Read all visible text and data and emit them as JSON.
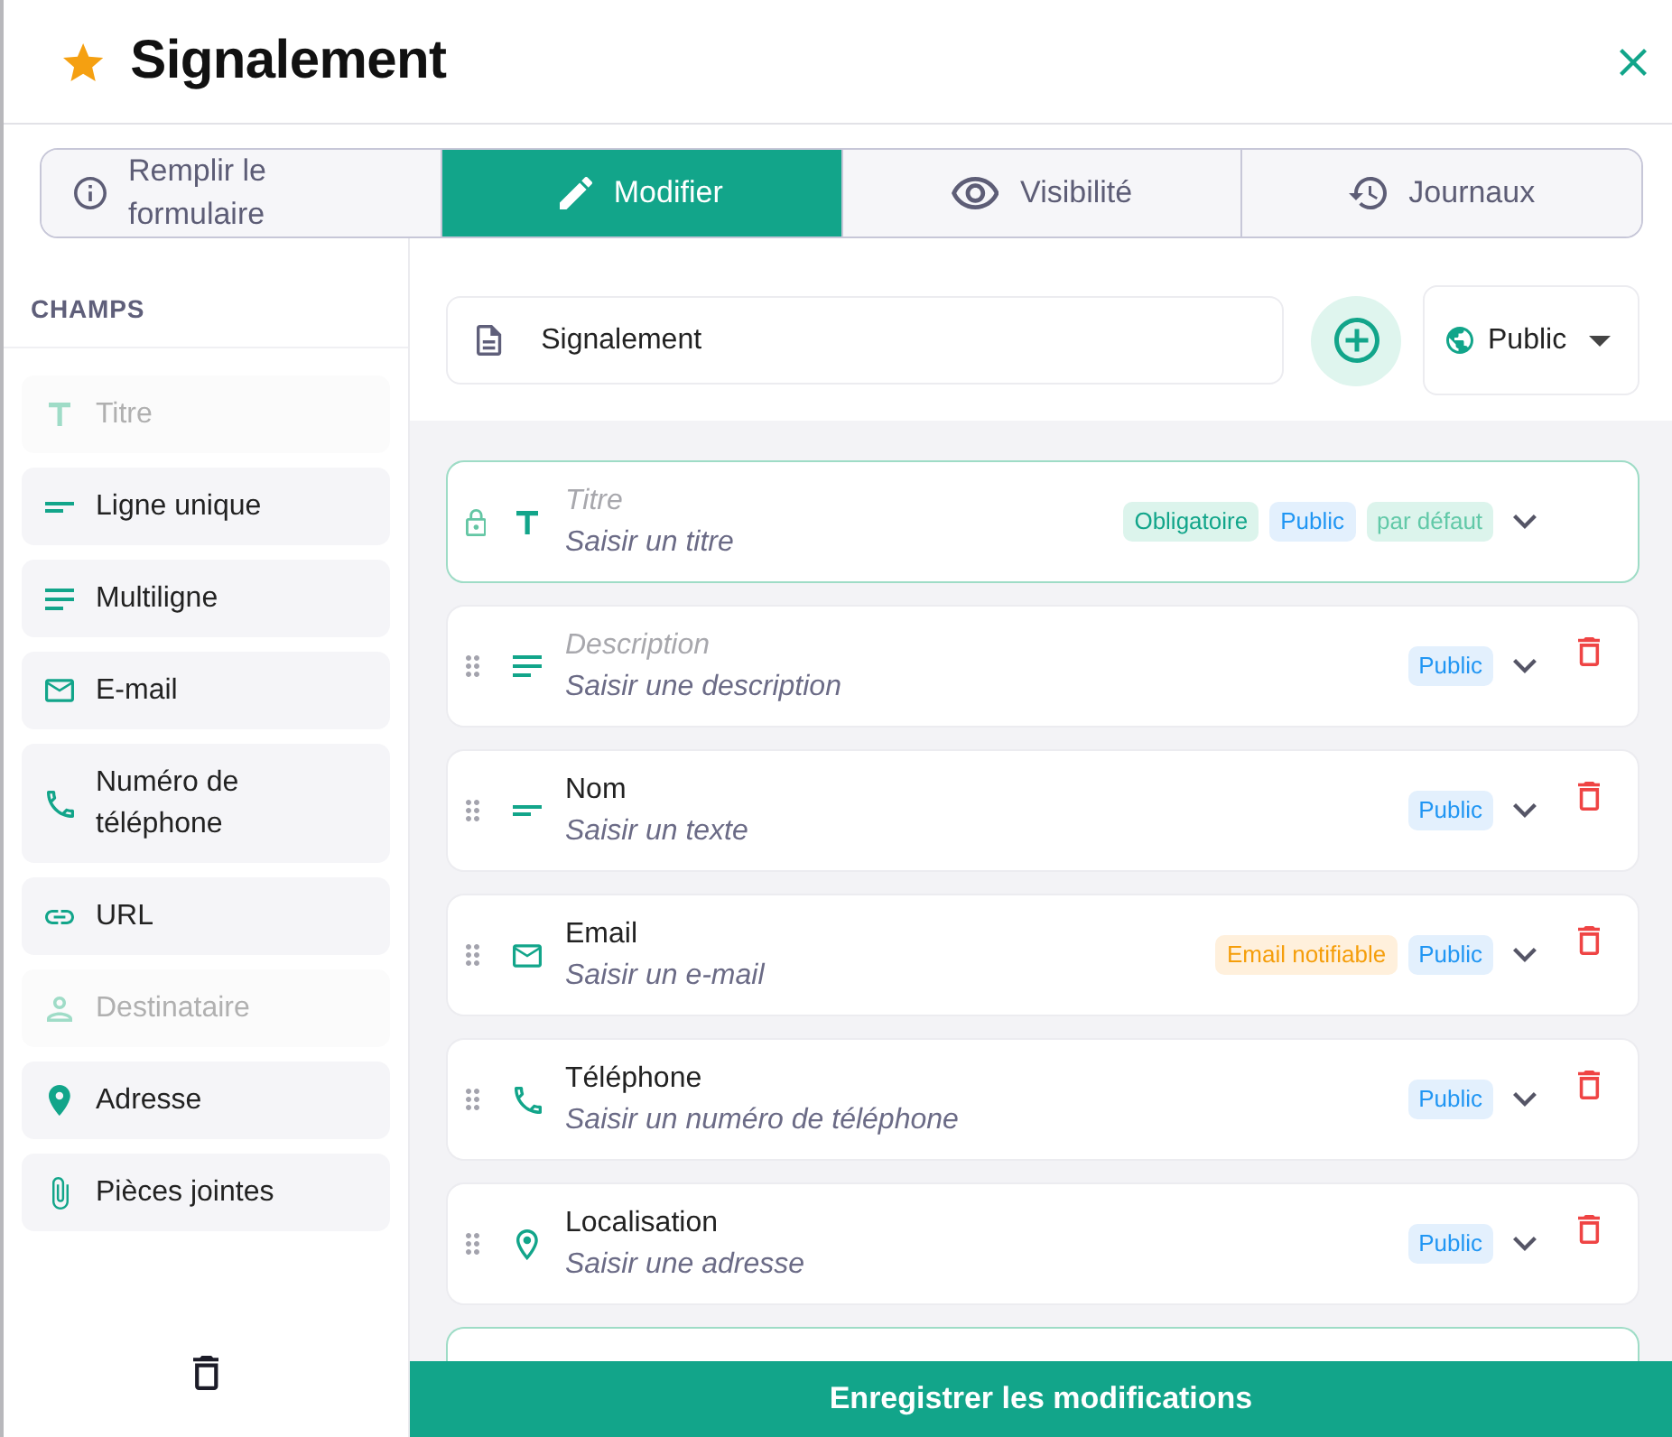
{
  "window": {
    "title": "Signalement"
  },
  "tabs": [
    {
      "label": "Remplir le formulaire",
      "selected": false
    },
    {
      "label": "Modifier",
      "selected": true
    },
    {
      "label": "Visibilité",
      "selected": false
    },
    {
      "label": "Journaux",
      "selected": false
    }
  ],
  "sidebar": {
    "heading": "CHAMPS",
    "items": [
      {
        "kind": "title",
        "label": "Titre",
        "disabled": true
      },
      {
        "kind": "single_line",
        "label": "Ligne unique",
        "disabled": false
      },
      {
        "kind": "multiline",
        "label": "Multiligne",
        "disabled": false
      },
      {
        "kind": "email",
        "label": "E-mail",
        "disabled": false
      },
      {
        "kind": "phone",
        "label": "Numéro de téléphone",
        "disabled": false
      },
      {
        "kind": "url",
        "label": "URL",
        "disabled": false
      },
      {
        "kind": "recipient",
        "label": "Destinataire",
        "disabled": true
      },
      {
        "kind": "address",
        "label": "Adresse",
        "disabled": false
      },
      {
        "kind": "attachment",
        "label": "Pièces jointes",
        "disabled": false
      }
    ]
  },
  "form_name": {
    "value": "Signalement"
  },
  "visibility_select": {
    "value": "Public"
  },
  "fields": [
    {
      "kind": "title",
      "label": "Titre",
      "label_default": true,
      "hint": "Saisir un titre",
      "locked": true,
      "badges": [
        {
          "kind": "required",
          "text": "Obligatoire"
        },
        {
          "kind": "public",
          "text": "Public"
        },
        {
          "kind": "default",
          "text": "par défaut"
        }
      ]
    },
    {
      "kind": "multiline",
      "label": "Description",
      "label_default": true,
      "hint": "Saisir une description",
      "locked": false,
      "badges": [
        {
          "kind": "public",
          "text": "Public"
        }
      ]
    },
    {
      "kind": "single_line",
      "label": "Nom",
      "label_default": false,
      "hint": "Saisir un texte",
      "locked": false,
      "badges": [
        {
          "kind": "public",
          "text": "Public"
        }
      ]
    },
    {
      "kind": "email",
      "label": "Email",
      "label_default": false,
      "hint": "Saisir un e-mail",
      "locked": false,
      "badges": [
        {
          "kind": "notifiable",
          "text": "Email notifiable"
        },
        {
          "kind": "public",
          "text": "Public"
        }
      ]
    },
    {
      "kind": "phone",
      "label": "Téléphone",
      "label_default": false,
      "hint": "Saisir un numéro de téléphone",
      "locked": false,
      "badges": [
        {
          "kind": "public",
          "text": "Public"
        }
      ]
    },
    {
      "kind": "address",
      "label": "Localisation",
      "label_default": false,
      "hint": "Saisir une adresse",
      "locked": false,
      "badges": [
        {
          "kind": "public",
          "text": "Public"
        }
      ]
    }
  ],
  "save_button": {
    "label": "Enregistrer les modifications"
  }
}
